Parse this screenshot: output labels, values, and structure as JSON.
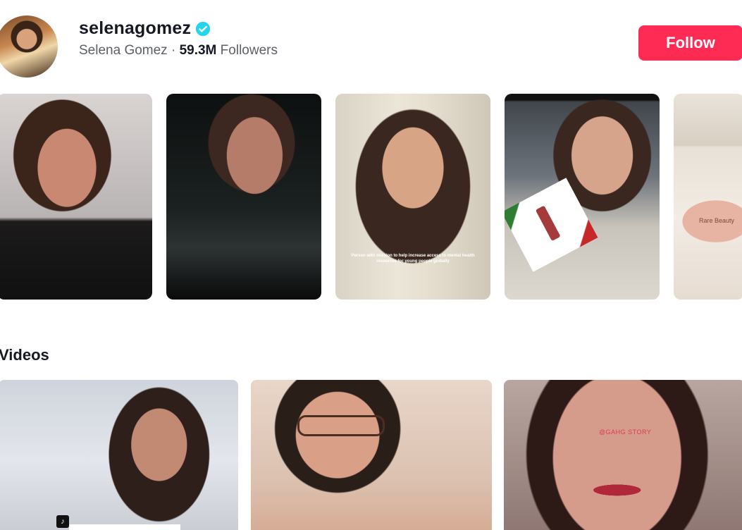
{
  "profile": {
    "username": "selenagomez",
    "display_name": "Selena Gomez",
    "separator": "·",
    "followers_count": "59.3M",
    "followers_label": "Followers",
    "verified": true,
    "follow_label": "Follow"
  },
  "stories": [
    {
      "caption": ""
    },
    {
      "caption": ""
    },
    {
      "caption": "Person with mission to help increase access to mental health resources for young people globally"
    },
    {
      "caption": ""
    },
    {
      "caption": "",
      "jar_text": "Rare Beauty"
    }
  ],
  "videos_section": {
    "title": "Videos",
    "videos": [
      {
        "badge_icon": "tiktok-logo-icon"
      },
      {},
      {
        "watermark": "@GAHG STORY"
      }
    ]
  },
  "colors": {
    "follow_button": "#fe2c55",
    "verified_badge": "#20d5ec",
    "text_primary": "#161823",
    "text_secondary": "#5c5f66"
  }
}
